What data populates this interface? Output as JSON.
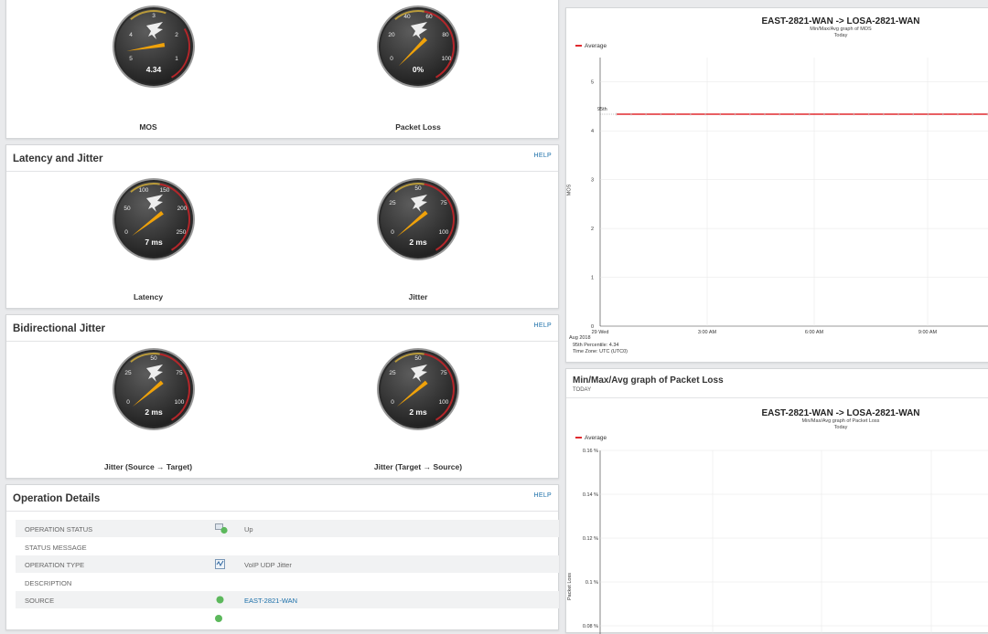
{
  "gauges_top": {
    "mos": {
      "label": "MOS",
      "value": "4.34",
      "ticks": [
        "3",
        "4",
        "2",
        "5",
        "1"
      ]
    },
    "packet_loss": {
      "label": "Packet Loss",
      "value": "0%",
      "ticks": [
        "40",
        "60",
        "20",
        "80",
        "0",
        "100"
      ]
    }
  },
  "latency_jitter": {
    "title": "Latency and Jitter",
    "help": "HELP",
    "latency": {
      "label": "Latency",
      "value": "7 ms",
      "ticks": [
        "100",
        "150",
        "50",
        "200",
        "0",
        "250"
      ]
    },
    "jitter": {
      "label": "Jitter",
      "value": "2 ms",
      "ticks": [
        "50",
        "25",
        "75",
        "0",
        "100"
      ]
    }
  },
  "bidirectional": {
    "title": "Bidirectional Jitter",
    "help": "HELP",
    "source_target": {
      "label": "Jitter (Source → Target)",
      "value": "2 ms",
      "ticks": [
        "50",
        "25",
        "75",
        "0",
        "100"
      ]
    },
    "target_source": {
      "label": "Jitter (Target → Source)",
      "value": "2 ms",
      "ticks": [
        "50",
        "25",
        "75",
        "0",
        "100"
      ]
    }
  },
  "operation_details": {
    "title": "Operation Details",
    "help": "HELP",
    "rows": [
      {
        "key": "OPERATION STATUS",
        "value": "Up"
      },
      {
        "key": "STATUS MESSAGE",
        "value": ""
      },
      {
        "key": "OPERATION TYPE",
        "value": "VoIP UDP Jitter"
      },
      {
        "key": "DESCRIPTION",
        "value": ""
      },
      {
        "key": "SOURCE",
        "value": "EAST-2821-WAN"
      }
    ]
  },
  "mos_chart": {
    "title": "EAST-2821-WAN -> LOSA-2821-WAN",
    "subtitle": "Min/Max/Avg graph of MOS",
    "period": "Today",
    "legend": "Average",
    "ylabel": "MOS",
    "yticks": [
      "5",
      "4",
      "3",
      "2",
      "1",
      "0"
    ],
    "xticks": [
      "29 Wed",
      "3:00 AM",
      "6:00 AM",
      "9:00 AM"
    ],
    "xdate": "Aug 2018",
    "percentile_marker": "95th",
    "percentile_note": "95th Percentile: 4.34",
    "timezone": "Time Zone: UTC (UTC0)"
  },
  "packet_loss_panel": {
    "title": "Min/Max/Avg graph of Packet Loss",
    "period_label": "TODAY"
  },
  "packet_loss_chart": {
    "title": "EAST-2821-WAN -> LOSA-2821-WAN",
    "subtitle": "Min/Max/Avg graph of Packet Loss",
    "period": "Today",
    "legend": "Average",
    "ylabel": "Packet Loss",
    "yticks": [
      "0.16 %",
      "0.14 %",
      "0.12 %",
      "0.1 %",
      "0.08 %"
    ]
  },
  "chart_data": [
    {
      "type": "line",
      "title": "EAST-2821-WAN -> LOSA-2821-WAN",
      "subtitle": "Min/Max/Avg graph of MOS",
      "ylabel": "MOS",
      "ylim": [
        0,
        5.5
      ],
      "x": [
        "29 Wed",
        "3:00 AM",
        "6:00 AM",
        "9:00 AM"
      ],
      "series": [
        {
          "name": "Average",
          "values": [
            4.34,
            4.34,
            4.34,
            4.34
          ]
        }
      ],
      "percentile_95": 4.34,
      "color": "#e0292e"
    },
    {
      "type": "line",
      "title": "EAST-2821-WAN -> LOSA-2821-WAN",
      "subtitle": "Min/Max/Avg graph of Packet Loss",
      "ylabel": "Packet Loss",
      "ylim": [
        0.06,
        0.16
      ],
      "series": [
        {
          "name": "Average",
          "values": []
        }
      ]
    }
  ],
  "gauge_values": {
    "mos": {
      "value": 4.34,
      "min": 5,
      "max": 0
    },
    "packet_loss": {
      "value": 0,
      "min": 0,
      "max": 100
    },
    "latency": {
      "value": 7,
      "min": 0,
      "max": 250
    },
    "jitter": {
      "value": 2,
      "min": 0,
      "max": 100
    },
    "jitter_st": {
      "value": 2,
      "min": 0,
      "max": 100
    },
    "jitter_ts": {
      "value": 2,
      "min": 0,
      "max": 100
    }
  },
  "colors": {
    "accent_red": "#e0292e",
    "needle": "#f0a20a",
    "link": "#1b6fa9",
    "status_green": "#5cb85c"
  }
}
